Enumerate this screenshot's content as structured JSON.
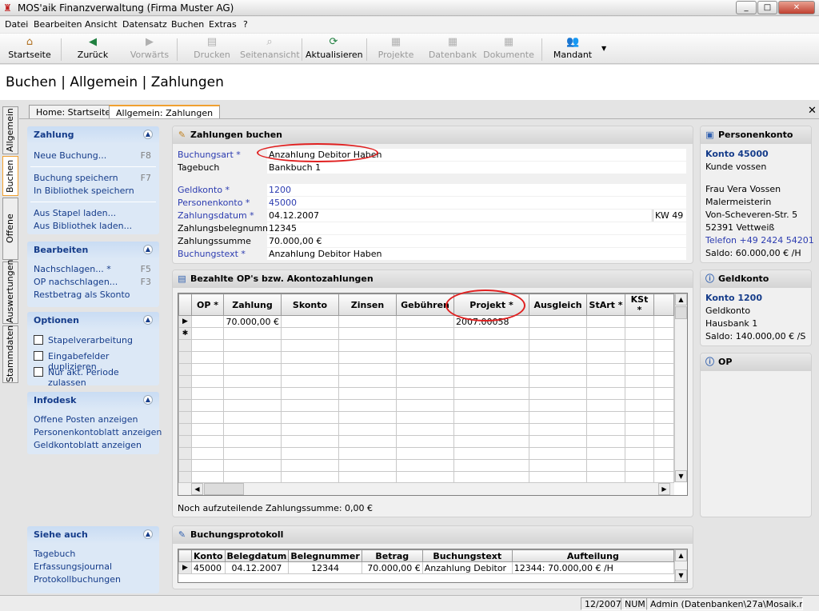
{
  "window": {
    "title": "MOS'aik Finanzverwaltung (Firma Muster AG)",
    "min": "_",
    "max": "□",
    "close": "✕"
  },
  "menu": [
    "Datei",
    "Bearbeiten",
    "Ansicht",
    "Datensatz",
    "Buchen",
    "Extras",
    "?"
  ],
  "toolbar": {
    "startseite": "Startseite",
    "zurueck": "Zurück",
    "vorwaerts": "Vorwärts",
    "drucken": "Drucken",
    "seitenansicht": "Seitenansicht",
    "aktualisieren": "Aktualisieren",
    "projekte": "Projekte",
    "datenbank": "Datenbank",
    "dokumente": "Dokumente",
    "mandant": "Mandant"
  },
  "page_title": "Buchen | Allgemein | Zahlungen",
  "tabs": [
    "Home: Startseite",
    "Allgemein: Zahlungen"
  ],
  "vertical_tabs": [
    "Allgemein",
    "Buchen",
    "Offene Posten",
    "Auswertungen",
    "Stammdaten"
  ],
  "taskpane": {
    "zahlung": {
      "title": "Zahlung",
      "items": [
        {
          "label": "Neue Buchung...",
          "key": "F8"
        },
        {
          "label": "Buchung speichern",
          "key": "F7"
        },
        {
          "label": "In Bibliothek speichern",
          "key": ""
        },
        {
          "label": "Aus Stapel laden...",
          "key": ""
        },
        {
          "label": "Aus Bibliothek laden...",
          "key": ""
        }
      ]
    },
    "bearbeiten": {
      "title": "Bearbeiten",
      "items": [
        {
          "label": "Nachschlagen... *",
          "key": "F5"
        },
        {
          "label": "OP nachschlagen...",
          "key": "F3"
        },
        {
          "label": "Restbetrag als Skonto",
          "key": ""
        }
      ]
    },
    "optionen": {
      "title": "Optionen",
      "items": [
        "Stapelverarbeitung",
        "Eingabefelder duplizieren",
        "Nur akt. Periode zulassen"
      ]
    },
    "infodesk": {
      "title": "Infodesk",
      "items": [
        "Offene Posten anzeigen",
        "Personenkontoblatt anzeigen",
        "Geldkontoblatt anzeigen"
      ]
    },
    "siehe": {
      "title": "Siehe auch",
      "items": [
        "Tagebuch",
        "Erfassungsjournal",
        "Protokollbuchungen"
      ]
    }
  },
  "zahlungen": {
    "title": "Zahlungen buchen",
    "fields": [
      {
        "label": "Buchungsart *",
        "value": "Anzahlung Debitor Haben",
        "link": true
      },
      {
        "label": "Tagebuch",
        "value": "Bankbuch 1",
        "link": false
      },
      {
        "label": "Geldkonto *",
        "value": "1200",
        "link": true
      },
      {
        "label": "Personenkonto *",
        "value": "45000",
        "link": true
      },
      {
        "label": "Zahlungsdatum *",
        "value": "04.12.2007",
        "link": true,
        "extra": "KW 49"
      },
      {
        "label": "Zahlungsbelegnummer",
        "value": "12345",
        "link": false
      },
      {
        "label": "Zahlungssumme",
        "value": "70.000,00 €",
        "link": false
      },
      {
        "label": "Buchungstext *",
        "value": "Anzahlung Debitor Haben",
        "link": true
      }
    ]
  },
  "ops": {
    "title": "Bezahlte OP's bzw. Akontozahlungen",
    "columns": [
      "OP *",
      "Zahlung",
      "Skonto",
      "Zinsen",
      "Gebühren",
      "Projekt *",
      "Ausgleich",
      "StArt *",
      "KSt *"
    ],
    "rows": [
      [
        "",
        "70.000,00 €",
        "",
        "",
        "",
        "2007.00058",
        "",
        "",
        ""
      ]
    ],
    "remaining": "Noch aufzuteilende Zahlungssumme: 0,00 €"
  },
  "protokoll": {
    "title": "Buchungsprotokoll",
    "columns": [
      "Konto",
      "Belegdatum",
      "Belegnummer",
      "Betrag",
      "Buchungstext",
      "Aufteilung"
    ],
    "rows": [
      [
        "45000",
        "04.12.2007",
        "12344",
        "70.000,00 €",
        "Anzahlung Debitor",
        "12344: 70.000,00 € /H"
      ]
    ]
  },
  "personenkonto": {
    "title": "Personenkonto",
    "konto": "Konto 45000",
    "type": "Kunde vossen",
    "lines": [
      "Frau Vera Vossen",
      "Malermeisterin",
      "Von-Scheveren-Str. 5",
      "52391 Vettweiß"
    ],
    "phone": "Telefon +49 2424 54201",
    "saldo": "Saldo: 60.000,00 € /H"
  },
  "geldkonto": {
    "title": "Geldkonto",
    "konto": "Konto 1200",
    "type": "Geldkonto",
    "name": "Hausbank 1",
    "saldo": "Saldo: 140.000,00 € /S"
  },
  "op": {
    "title": "OP"
  },
  "status": {
    "period": "12/2007",
    "num": "NUM",
    "user": "Admin (Datenbanken\\27a\\Mosaik.mdb)"
  },
  "colors": {
    "link": "#2b3bb0",
    "taskpane_head": "#153c8a",
    "highlight": "#e02020",
    "active_tab": "#f0a030"
  }
}
